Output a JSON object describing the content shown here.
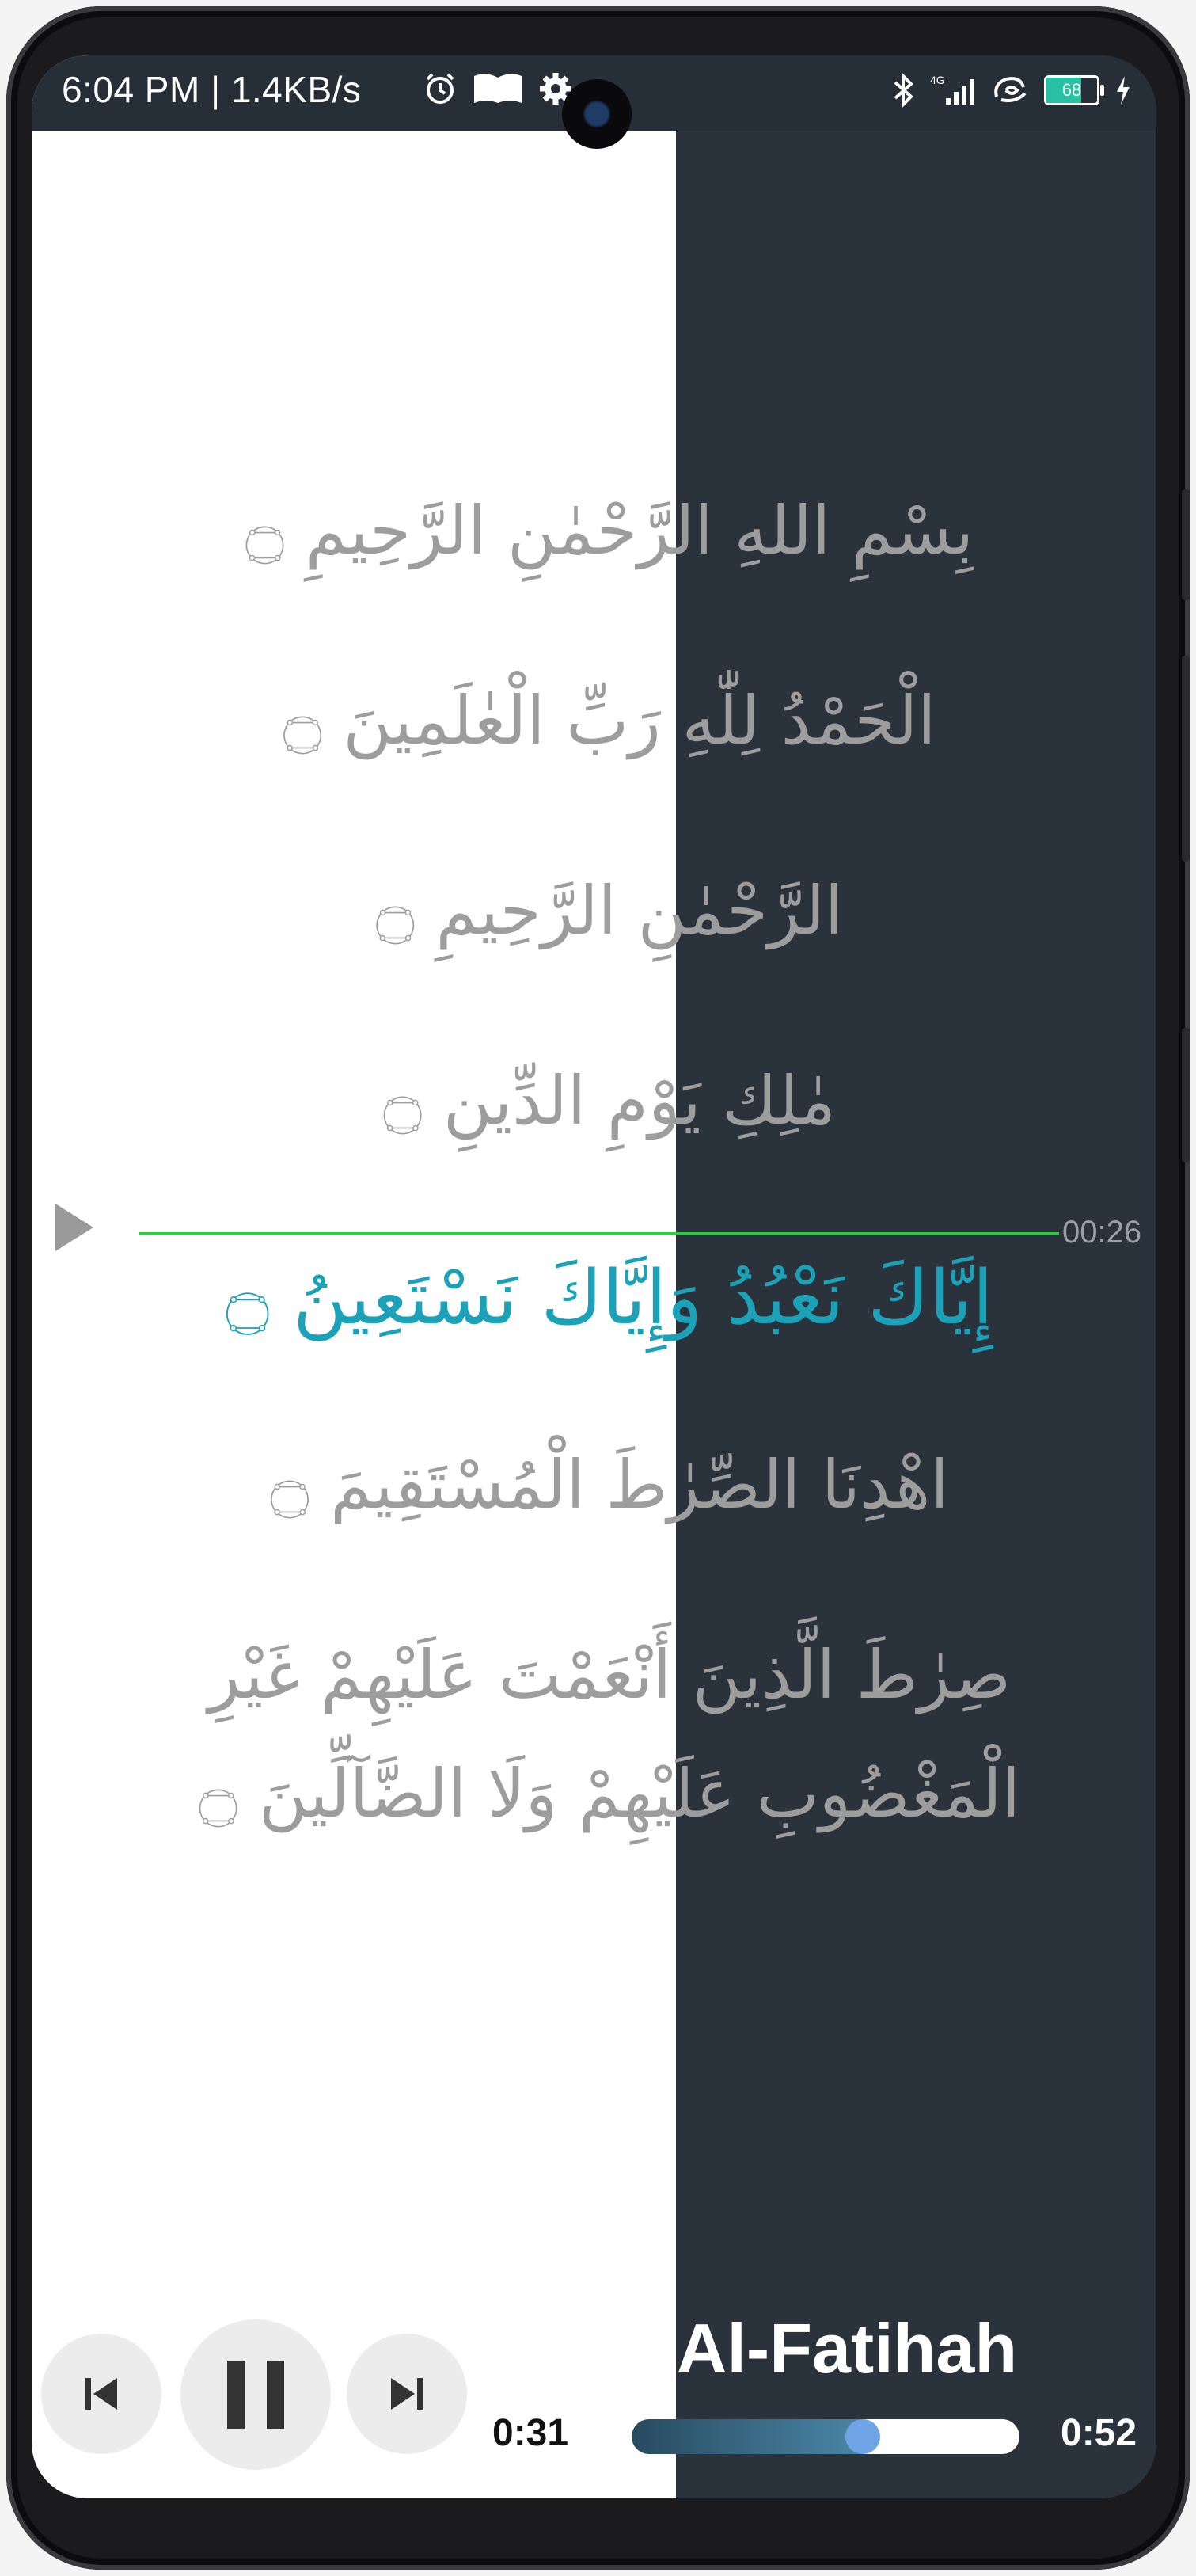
{
  "status_bar": {
    "text": "6:04 PM | 1.4KB/s",
    "battery": "68",
    "icons": [
      "alarm-icon",
      "book-icon",
      "gear-icon",
      "bluetooth-icon",
      "signal-4g-icon",
      "hotspot-icon",
      "battery-icon",
      "charging-icon"
    ]
  },
  "verses": [
    "بِسْمِ اللهِ الرَّحْمٰنِ الرَّحِيمِ ۝",
    "الْحَمْدُ لِلّٰهِ رَبِّ الْعٰلَمِينَ ۝",
    "الرَّحْمٰنِ الرَّحِيمِ ۝",
    "مٰلِكِ يَوْمِ الدِّينِ ۝",
    "إِيَّاكَ نَعْبُدُ وَإِيَّاكَ نَسْتَعِينُ ۝",
    "اهْدِنَا الصِّرٰطَ الْمُسْتَقِيمَ ۝",
    "صِرٰطَ الَّذِينَ أَنْعَمْتَ عَلَيْهِمْ غَيْرِ الْمَغْضُوبِ عَلَيْهِمْ وَلَا الضَّآلِّينَ ۝"
  ],
  "active_verse_index": 4,
  "active_verse_time": "00:26",
  "player": {
    "title": "Al-Fatihah",
    "elapsed": "0:31",
    "total": "0:52",
    "progress_fraction": 0.596,
    "accent_color": "#1ba2b8",
    "highlight_line_color": "#2ecc40"
  }
}
